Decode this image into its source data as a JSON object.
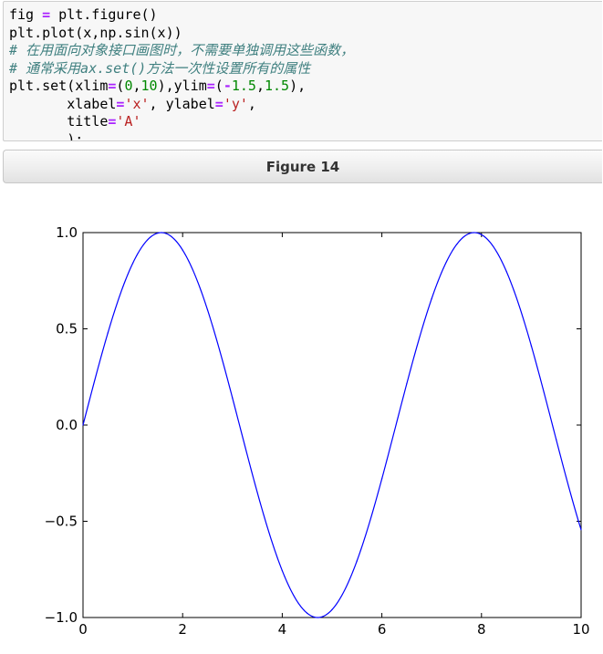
{
  "code_cell": {
    "lines": [
      [
        {
          "t": "fig "
        },
        {
          "t": "=",
          "c": "op"
        },
        {
          "t": " plt.figure()"
        }
      ],
      [
        {
          "t": "plt.plot(x,np.sin(x))"
        }
      ],
      [
        {
          "t": "# 在用面向对象接口画图时，不需要单独调用这些函数，",
          "c": "comment"
        }
      ],
      [
        {
          "t": "# 通常采用ax.set()方法一次性设置所有的属性",
          "c": "comment"
        }
      ],
      [
        {
          "t": "plt.set(xlim"
        },
        {
          "t": "=",
          "c": "op"
        },
        {
          "t": "("
        },
        {
          "t": "0",
          "c": "num"
        },
        {
          "t": ","
        },
        {
          "t": "10",
          "c": "num"
        },
        {
          "t": "),ylim"
        },
        {
          "t": "=",
          "c": "op"
        },
        {
          "t": "("
        },
        {
          "t": "-",
          "c": "op"
        },
        {
          "t": "1.5",
          "c": "num"
        },
        {
          "t": ","
        },
        {
          "t": "1.5",
          "c": "num"
        },
        {
          "t": "),"
        }
      ],
      [
        {
          "t": "       xlabel"
        },
        {
          "t": "=",
          "c": "op"
        },
        {
          "t": "'x'",
          "c": "str"
        },
        {
          "t": ", ylabel"
        },
        {
          "t": "=",
          "c": "op"
        },
        {
          "t": "'y'",
          "c": "str"
        },
        {
          "t": ","
        }
      ],
      [
        {
          "t": "       title"
        },
        {
          "t": "=",
          "c": "op"
        },
        {
          "t": "'A'",
          "c": "str"
        }
      ],
      [
        {
          "t": "       );"
        }
      ]
    ]
  },
  "figure": {
    "title": "Figure 14"
  },
  "colors": {
    "line": "#0000ff",
    "code_background": "#f7f7f7"
  },
  "chart_data": {
    "type": "line",
    "function": "sin",
    "x": [
      0,
      0.5,
      1,
      1.5,
      2,
      2.5,
      3,
      3.5,
      4,
      4.5,
      5,
      5.5,
      6,
      6.5,
      7,
      7.5,
      8,
      8.5,
      9,
      9.5,
      10
    ],
    "y": [
      0.0,
      0.479,
      0.841,
      0.997,
      0.909,
      0.598,
      0.141,
      -0.351,
      -0.757,
      -0.978,
      -0.959,
      -0.706,
      -0.279,
      0.215,
      0.657,
      0.938,
      0.989,
      0.798,
      0.412,
      -0.075,
      -0.544
    ],
    "xlim": [
      0,
      10
    ],
    "ylim": [
      -1,
      1
    ],
    "x_ticks": [
      0,
      2,
      4,
      6,
      8,
      10
    ],
    "y_ticks": [
      -1.0,
      -0.5,
      0.0,
      0.5,
      1.0
    ],
    "x_tick_labels": [
      "0",
      "2",
      "4",
      "6",
      "8",
      "10"
    ],
    "y_tick_labels": [
      "−1.0",
      "−0.5",
      "0.0",
      "0.5",
      "1.0"
    ],
    "grid": false,
    "legend": false
  }
}
